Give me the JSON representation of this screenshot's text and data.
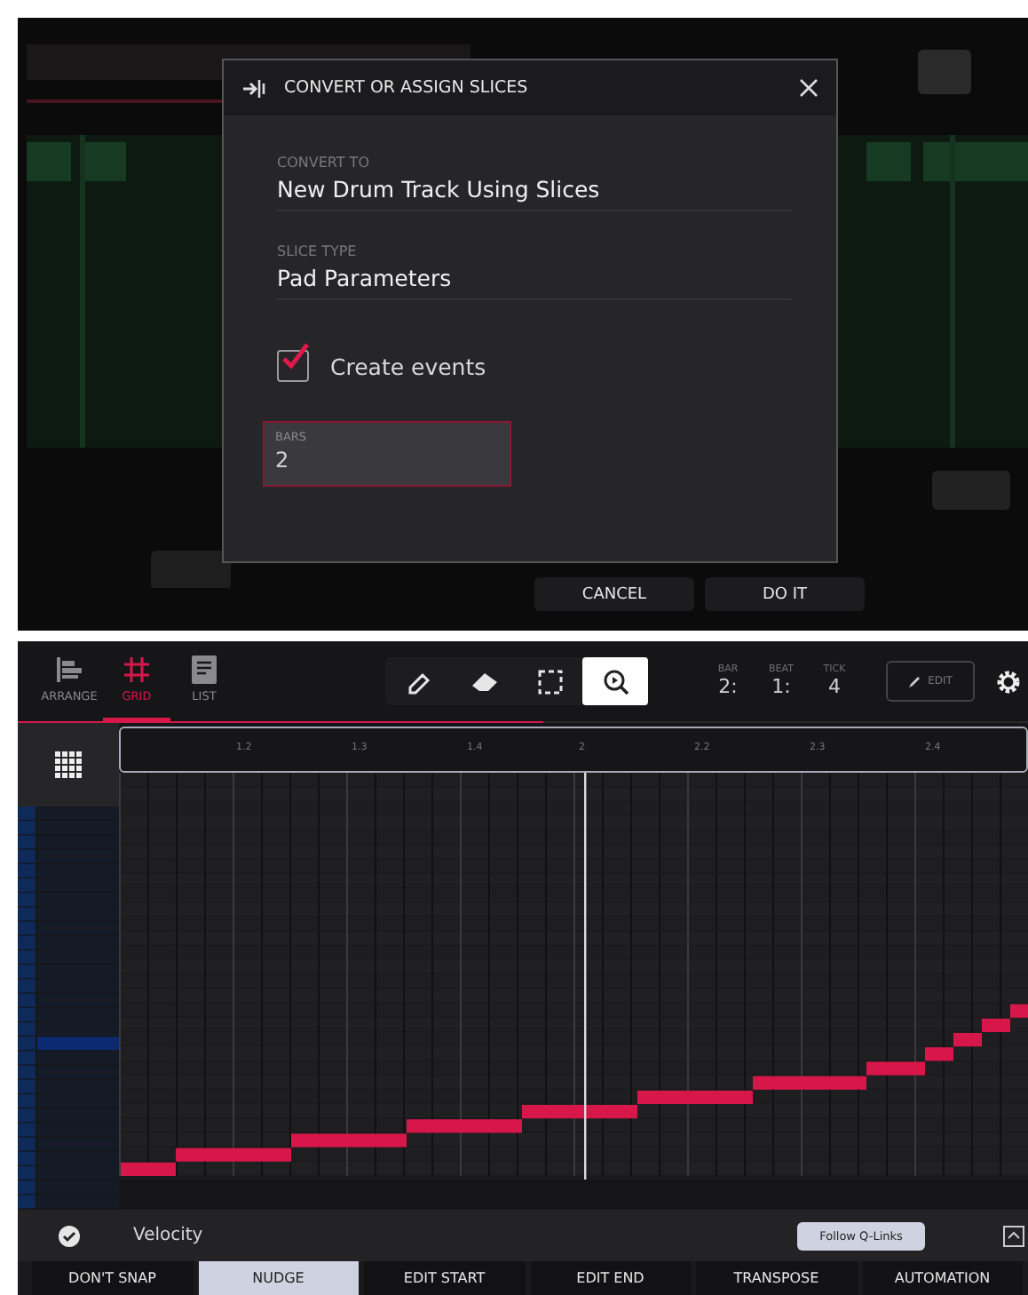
{
  "dialog": {
    "title": "CONVERT OR ASSIGN SLICES",
    "fields": [
      {
        "label": "CONVERT TO",
        "value": "New Drum Track Using Slices"
      },
      {
        "label": "SLICE TYPE",
        "value": "Pad Parameters"
      }
    ],
    "create_events": {
      "label": "Create events",
      "checked": true
    },
    "bars": {
      "label": "BARS",
      "value": "2"
    }
  },
  "dialog_buttons": [
    "CANCEL",
    "DO IT"
  ],
  "view_tabs": [
    {
      "kind": "arrange",
      "label": "ARRANGE",
      "selected": false
    },
    {
      "kind": "grid",
      "label": "GRID",
      "selected": true
    },
    {
      "kind": "list",
      "label": "LIST",
      "selected": false
    }
  ],
  "tools": [
    {
      "kind": "pencil",
      "selected": false
    },
    {
      "kind": "eraser",
      "selected": false
    },
    {
      "kind": "select",
      "selected": false
    },
    {
      "kind": "zoom",
      "selected": true
    }
  ],
  "position": [
    {
      "label": "BAR",
      "value": "2:"
    },
    {
      "label": "BEAT",
      "value": "1:"
    },
    {
      "label": "TICK",
      "value": "4"
    }
  ],
  "edit_button": "EDIT",
  "progress": {
    "level": 0.52
  },
  "ruler": [
    "1.2",
    "1.3",
    "1.4",
    "2",
    "2.2",
    "2.3",
    "2.4"
  ],
  "velocity": {
    "label": "Velocity",
    "follow_button": "Follow Q-Links"
  },
  "bottom_tabs": [
    {
      "label": "DON'T SNAP",
      "selected": false
    },
    {
      "label": "NUDGE",
      "selected": true
    },
    {
      "label": "EDIT START",
      "selected": false
    },
    {
      "label": "EDIT END",
      "selected": false
    },
    {
      "label": "TRANSPOSE",
      "selected": false
    },
    {
      "label": "AUTOMATION",
      "selected": false
    }
  ]
}
